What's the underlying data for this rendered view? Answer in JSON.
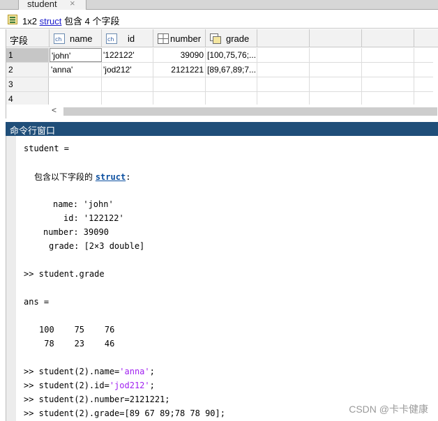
{
  "editor": {
    "tab_label": "student",
    "tab_close": "×",
    "info_prefix": "1x2",
    "info_link": "struct",
    "info_suffix": "包含 4 个字段"
  },
  "grid": {
    "corner_label": "字段",
    "columns": [
      "name",
      "id",
      "number",
      "grade"
    ],
    "rows": [
      {
        "index": "1",
        "name": "'john'",
        "id": "'122122'",
        "number": "39090",
        "grade": "[100,75,76;..."
      },
      {
        "index": "2",
        "name": "'anna'",
        "id": "'jod212'",
        "number": "2121221",
        "grade": "[89,67,89;7..."
      },
      {
        "index": "3",
        "name": "",
        "id": "",
        "number": "",
        "grade": ""
      },
      {
        "index": "4",
        "name": "",
        "id": "",
        "number": "",
        "grade": ""
      }
    ],
    "scroll_left": "<"
  },
  "command_window": {
    "title": "命令行窗口",
    "lines": {
      "l1": "student =",
      "l2a": "包含以下字段的 ",
      "l2b": "struct",
      "l2c": ":",
      "l3": "name: 'john'",
      "l4": "id: '122122'",
      "l5": "number: 39090",
      "l6": "grade: [2×3 double]",
      "l7": ">> student.grade",
      "l8": "ans =",
      "l9": "100    75    76",
      "l10": " 78    23    46",
      "l11a": ">> student(2).name=",
      "l11b": "'anna'",
      "l11c": ";",
      "l12a": ">> student(2).id=",
      "l12b": "'jod212'",
      "l12c": ";",
      "l13": ">> student(2).number=2121221;",
      "l14": ">> student(2).grade=[89 67 89;78 78 90];"
    }
  },
  "watermark": "CSDN @卡卡健康",
  "colors": {
    "title_bar": "#1f4e79",
    "link": "#1a1acc",
    "string": "#a020f0"
  }
}
